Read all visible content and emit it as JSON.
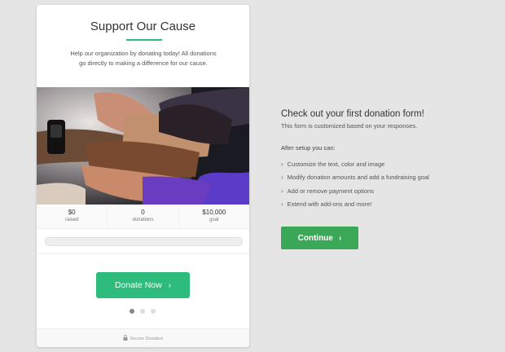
{
  "card": {
    "title": "Support Our Cause",
    "description": "Help our organization by donating today! All donations go directly to making a difference for our cause.",
    "image_alt": "stacked hands",
    "stats": [
      {
        "value": "$0",
        "label": "raised"
      },
      {
        "value": "0",
        "label": "donations"
      },
      {
        "value": "$10,000",
        "label": "goal"
      }
    ],
    "progress_fraction": 0,
    "donate_label": "Donate Now",
    "donate_icon": "chevron-right-icon",
    "pager": {
      "count": 3,
      "active_index": 0
    },
    "footer_text": "Secure Donation",
    "footer_icon": "lock-icon"
  },
  "panel": {
    "title": "Check out your first donation form!",
    "subtitle": "This form is customized based on your responses.",
    "after_label": "After setup you can:",
    "features": [
      "Customize the text, color and image",
      "Modify donation amounts and add a fundraising goal",
      "Add or remove payment options",
      "Extend with add-ons and more!"
    ],
    "continue_label": "Continue",
    "continue_icon": "chevron-right-icon"
  },
  "colors": {
    "background": "#e5e5e5",
    "accent_green": "#2ebc7c",
    "continue_green": "#3aa856"
  }
}
